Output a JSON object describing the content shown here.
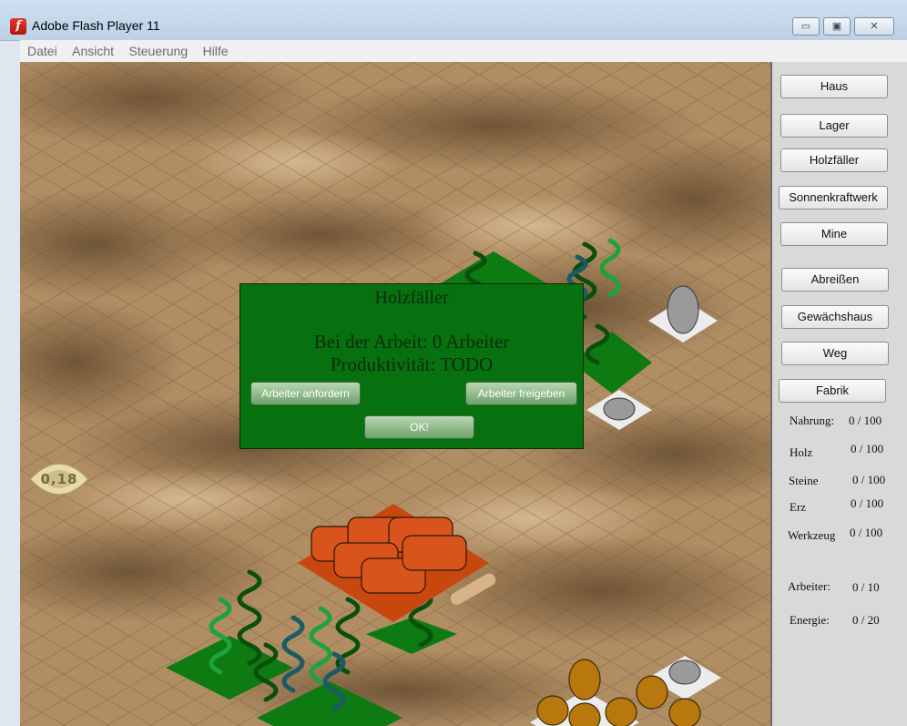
{
  "window": {
    "title": "Adobe Flash Player 11",
    "icon": "flash-icon",
    "controls": [
      "minimize-icon",
      "maximize-icon",
      "close-icon"
    ]
  },
  "menu": [
    "Datei",
    "Ansicht",
    "Steuerung",
    "Hilfe"
  ],
  "zoom_badge": "0,18",
  "dialog": {
    "title": "Holzfäller",
    "workers_text": "Bei der Arbeit: 0 Arbeiter",
    "productivity_text": "Produktivität: TODO",
    "request_button": "Arbeiter anfordern",
    "release_button": "Arbeiter freigeben",
    "ok_button": "OK!"
  },
  "build_menu": [
    "Haus",
    "Lager",
    "Holzfäller",
    "Sonnenkraftwerk",
    "Mine",
    "Abreißen",
    "Gewächshaus",
    "Weg",
    "Fabrik"
  ],
  "resources": [
    {
      "label": "Nahrung:",
      "value": "0 / 100"
    },
    {
      "label": "Holz",
      "value": "0 / 100"
    },
    {
      "label": "Steine",
      "value": "0 / 100"
    },
    {
      "label": "Erz",
      "value": "0 / 100"
    },
    {
      "label": "Werkzeug",
      "value": "0 / 100"
    }
  ],
  "stats": [
    {
      "label": "Arbeiter:",
      "value": "0 / 10"
    },
    {
      "label": "Energie:",
      "value": "0 / 20"
    }
  ],
  "colors": {
    "dialog_bg": "#07710f",
    "grass_tile": "#0d7a12",
    "building_tile": "#c8470f",
    "gold_resource": "#b8860b"
  }
}
